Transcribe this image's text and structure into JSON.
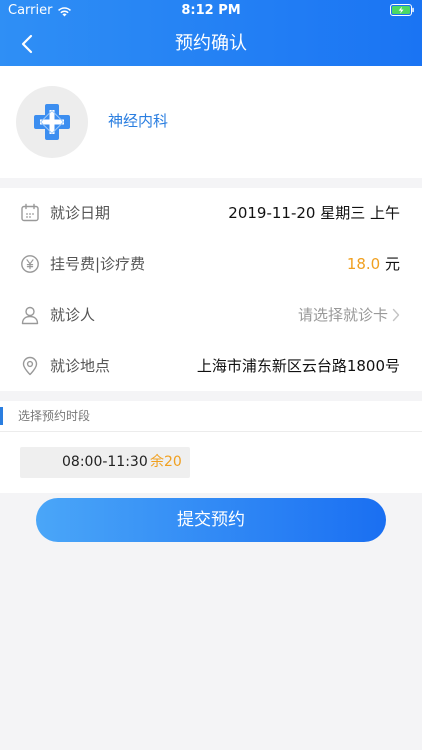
{
  "status_bar": {
    "carrier": "Carrier",
    "time": "8:12 PM"
  },
  "nav": {
    "title": "预约确认"
  },
  "department": {
    "name": "神经内科"
  },
  "info": {
    "date": {
      "label": "就诊日期",
      "value": "2019-11-20 星期三 上午"
    },
    "fee": {
      "label": "挂号费|诊疗费",
      "amount": "18.0",
      "unit": " 元"
    },
    "patient": {
      "label": "就诊人",
      "placeholder": "请选择就诊卡"
    },
    "location": {
      "label": "就诊地点",
      "value": "上海市浦东新区云台路1800号"
    }
  },
  "slots": {
    "title": "选择预约时段",
    "items": [
      {
        "time": "08:00-11:30",
        "remain": "余20"
      }
    ]
  },
  "submit": {
    "label": "提交预约"
  },
  "colors": {
    "primary": "#1a74f3",
    "accent": "#f0a020",
    "link": "#2a7ee0"
  },
  "icons": {
    "back": "chevron-left-icon",
    "date": "calendar-icon",
    "fee": "yen-icon",
    "patient": "user-icon",
    "location": "location-pin-icon",
    "hospital": "medical-cross-icon"
  }
}
